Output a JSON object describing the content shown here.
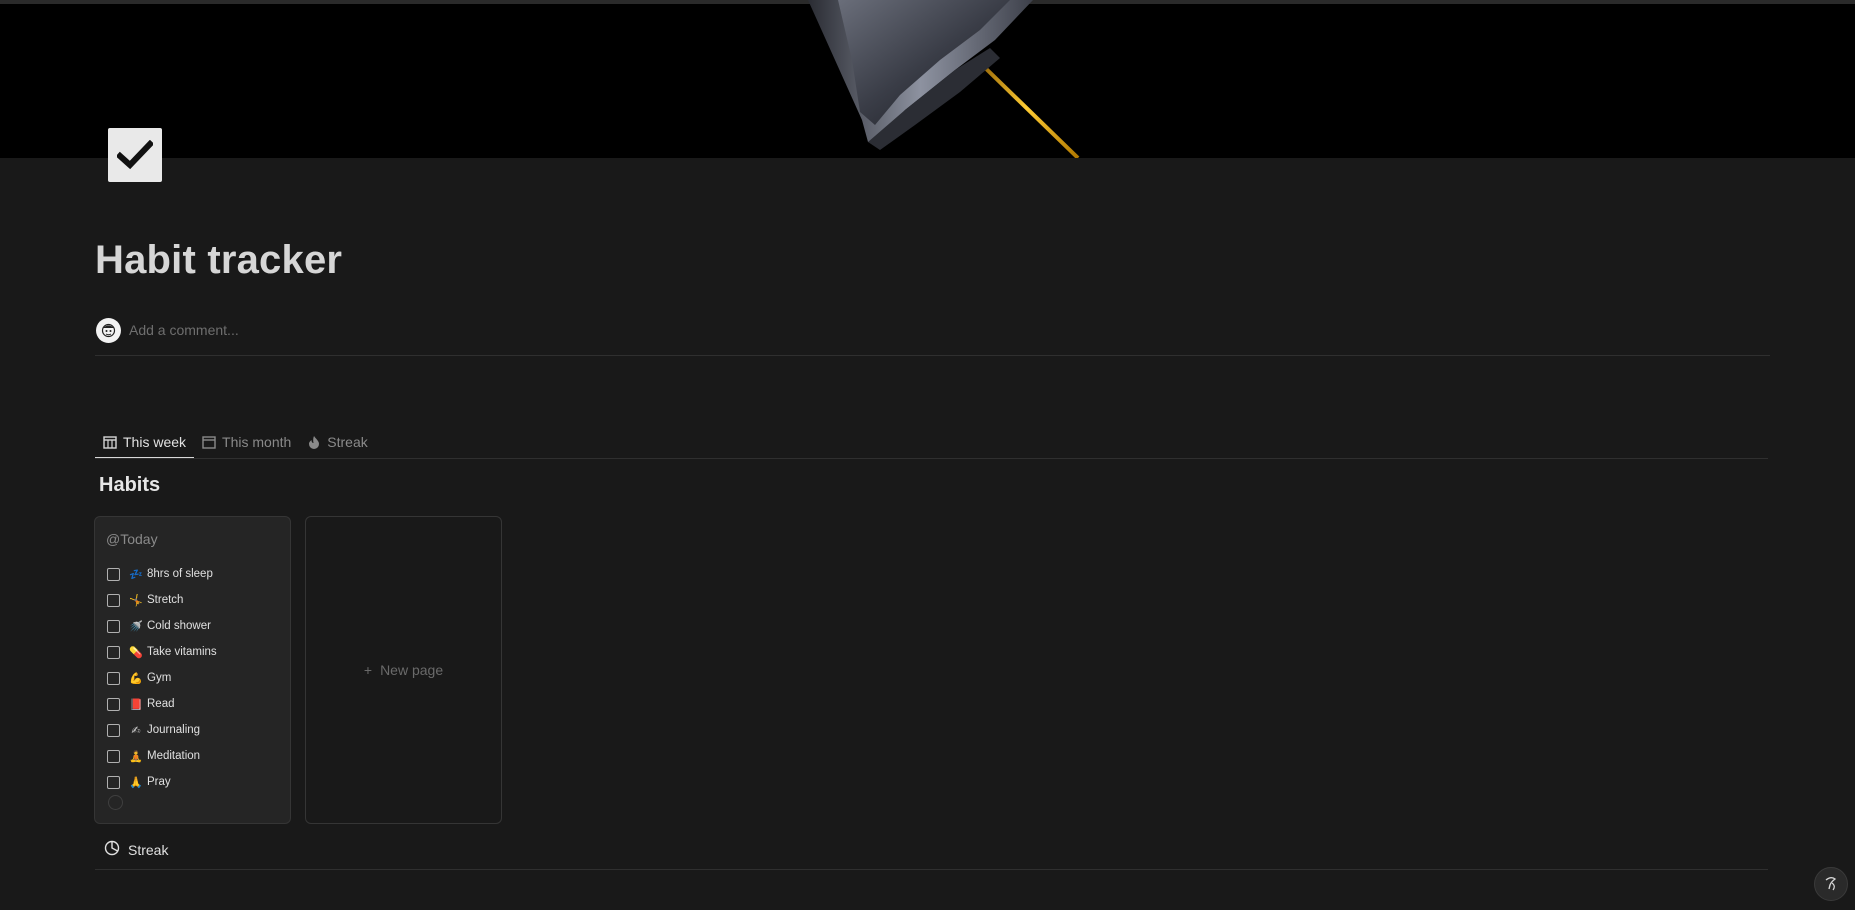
{
  "page": {
    "title": "Habit tracker",
    "icon": "checkmark-icon",
    "cover": "pushpin-cover-image"
  },
  "comment": {
    "placeholder": "Add a comment..."
  },
  "tabs": [
    {
      "label": "This week",
      "icon": "calendar-grid-icon",
      "active": true
    },
    {
      "label": "This month",
      "icon": "calendar-icon",
      "active": false
    },
    {
      "label": "Streak",
      "icon": "flame-icon",
      "active": false
    }
  ],
  "section": {
    "title": "Habits"
  },
  "today_card": {
    "header": "@Today",
    "habits": [
      {
        "label": "8hrs of sleep",
        "emoji": "💤",
        "checked": false
      },
      {
        "label": "Stretch",
        "emoji": "🤸",
        "checked": false
      },
      {
        "label": "Cold shower",
        "emoji": "🚿",
        "checked": false
      },
      {
        "label": "Take vitamins",
        "emoji": "💊",
        "checked": false
      },
      {
        "label": "Gym",
        "emoji": "💪",
        "checked": false
      },
      {
        "label": "Read",
        "emoji": "📕",
        "checked": false
      },
      {
        "label": "Journaling",
        "emoji": "✍",
        "checked": false
      },
      {
        "label": "Meditation",
        "emoji": "🧘",
        "checked": false
      },
      {
        "label": "Pray",
        "emoji": "🙏",
        "checked": false
      }
    ]
  },
  "new_page": {
    "plus": "+",
    "label": "New page"
  },
  "streak": {
    "label": "Streak",
    "icon": "pie-chart-icon"
  },
  "help": {
    "icon": "help-icon"
  }
}
